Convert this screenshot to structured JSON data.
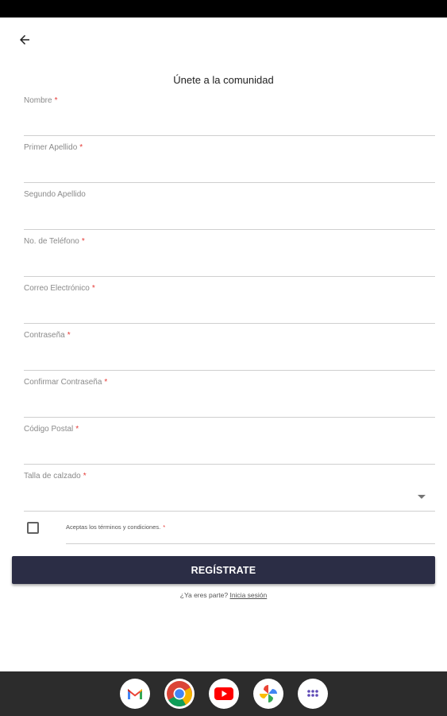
{
  "header": {
    "back_icon": "arrow-left-icon",
    "title": "Únete a la comunidad"
  },
  "form": {
    "fields": [
      {
        "label": "Nombre",
        "required": "*",
        "value": ""
      },
      {
        "label": "Primer Apellido",
        "required": "*",
        "value": ""
      },
      {
        "label": "Segundo Apellido",
        "required": "",
        "value": ""
      },
      {
        "label": "No. de Teléfono",
        "required": "*",
        "value": ""
      },
      {
        "label": "Correo Electrónico",
        "required": "*",
        "value": ""
      },
      {
        "label": "Contraseña",
        "required": "*",
        "value": ""
      },
      {
        "label": "Confirmar Contraseña",
        "required": "*",
        "value": ""
      },
      {
        "label": "Código Postal",
        "required": "*",
        "value": ""
      }
    ],
    "shoe_size": {
      "label": "Talla de calzado",
      "required": "*",
      "selected": ""
    },
    "terms": {
      "label": "Aceptas los términos y condiciones.",
      "required": "*",
      "checked": false
    },
    "submit_label": "REGÍSTRATE",
    "login_prompt": "¿Ya eres parte?",
    "login_link": "Inicia sesión"
  },
  "dock": {
    "apps": [
      "gmail-icon",
      "chrome-icon",
      "youtube-icon",
      "photos-icon",
      "app-drawer-icon"
    ]
  },
  "colors": {
    "primary_button": "#2b2d45",
    "required_mark": "#e53935",
    "status_bar": "#000000",
    "nav_bar": "#2c2c2c"
  }
}
